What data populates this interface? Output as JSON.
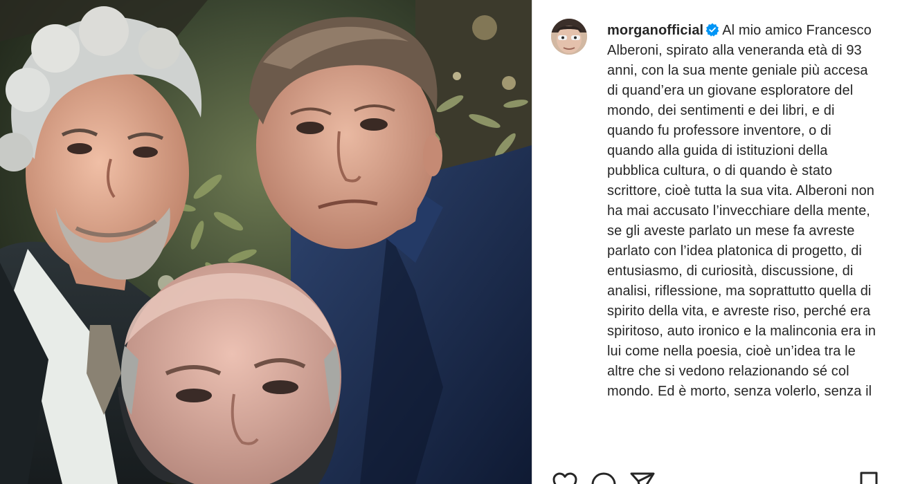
{
  "post": {
    "username": "morganofficial",
    "verified": true,
    "caption": "Al mio amico Francesco Alberoni, spirato alla veneranda età di 93 anni, con la sua mente geniale più accesa di quand’era un giovane esploratore del mondo, dei sentimenti e dei libri, e di quando fu professore inventore, o di quando alla guida di istituzioni della pubblica cultura, o di quando è stato scrittore, cioè tutta la sua vita. Alberoni non ha mai accusato l’invecchiare della mente, se gli aveste parlato un mese fa avreste parlato con l’idea platonica di progetto, di entusiasmo, di curiosità, discussione, di analisi, riflessione, ma soprattutto quella di spirito della vita, e avreste riso, perché era spiritoso, auto ironico e la malinconia era in lui come nella poesia, cioè un’idea tra le altre che si vedono relazionando sé col mondo. Ed è morto, senza volerlo, senza il",
    "photo": "selfie of three men"
  },
  "icons": {
    "avatar": "profile-avatar",
    "verified": "verified-badge-icon",
    "like": "heart-icon",
    "comment": "comment-icon",
    "share": "paper-plane-icon",
    "save": "bookmark-icon"
  },
  "colors": {
    "verified_blue": "#0095f6",
    "text": "#262626",
    "divider": "#dbdbdb"
  }
}
